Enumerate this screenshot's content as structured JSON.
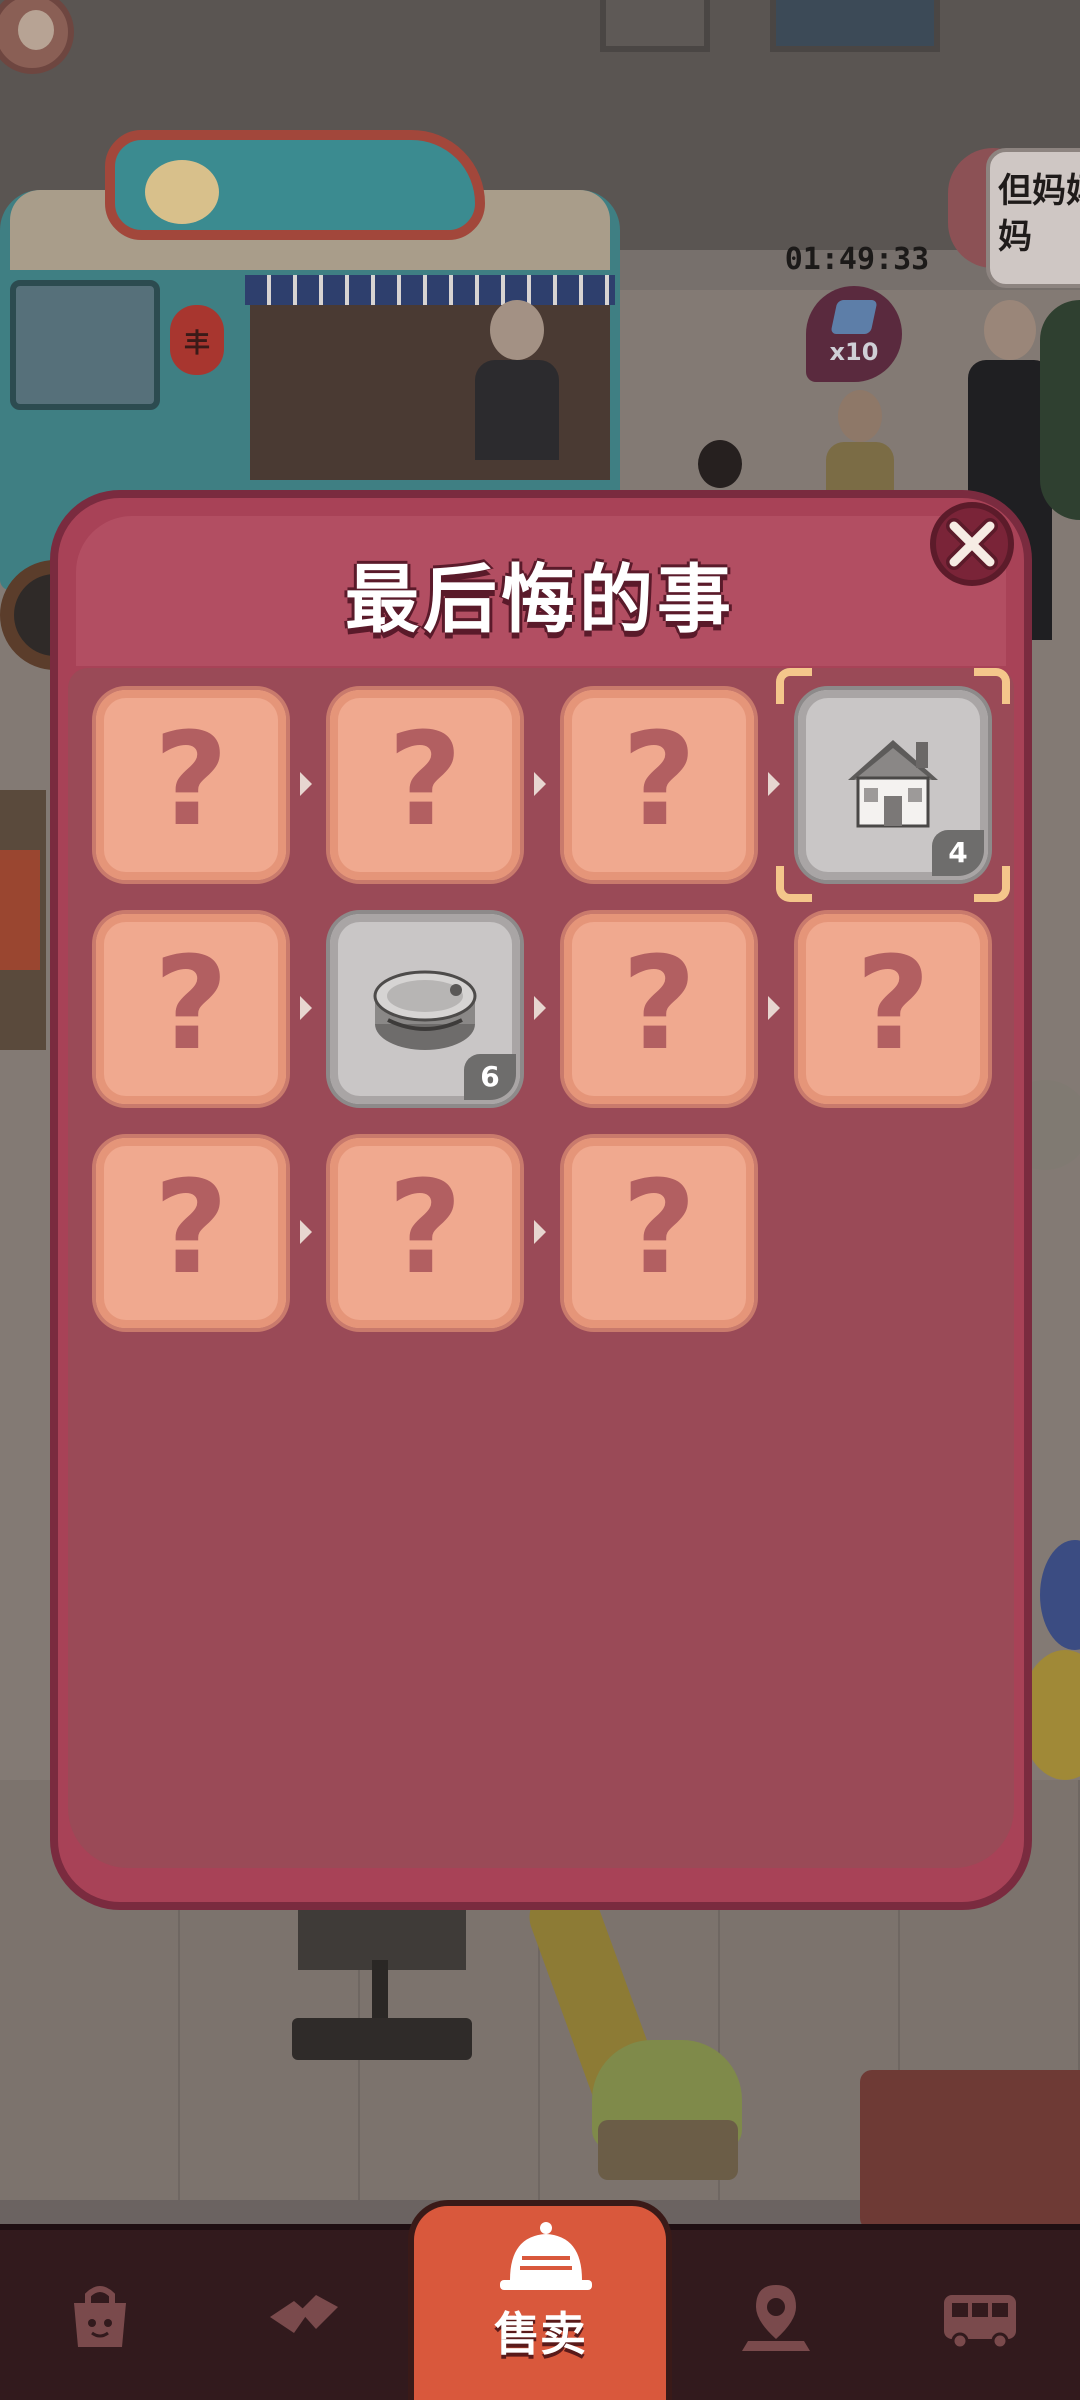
{
  "hud": {
    "timer": "01:49:33",
    "gem_reward": "x10",
    "speech_line1": "但妈妈",
    "speech_line2": "妈"
  },
  "modal": {
    "title": "最后悔的事",
    "rows": [
      [
        {
          "state": "locked",
          "label": "?"
        },
        {
          "state": "locked",
          "label": "?"
        },
        {
          "state": "locked",
          "label": "?"
        },
        {
          "state": "unlocked",
          "icon": "house-icon",
          "level": "4",
          "selected": true
        }
      ],
      [
        {
          "state": "locked",
          "label": "?"
        },
        {
          "state": "unlocked",
          "icon": "tin-can-icon",
          "level": "6",
          "selected": false
        },
        {
          "state": "locked",
          "label": "?"
        },
        {
          "state": "locked",
          "label": "?"
        }
      ],
      [
        {
          "state": "locked",
          "label": "?"
        },
        {
          "state": "locked",
          "label": "?"
        },
        {
          "state": "locked",
          "label": "?"
        }
      ]
    ]
  },
  "nav": {
    "items": [
      "shop-bag-icon",
      "handshake-icon",
      "sell-bell-icon",
      "map-pin-icon",
      "bus-icon"
    ],
    "center_label": "售卖"
  },
  "colors": {
    "modal_bg": "#a84257",
    "locked_tile": "#f0a98f",
    "unlocked_tile": "#c9c6c6",
    "selection": "#f4c68b",
    "nav_active": "#d9583c"
  }
}
